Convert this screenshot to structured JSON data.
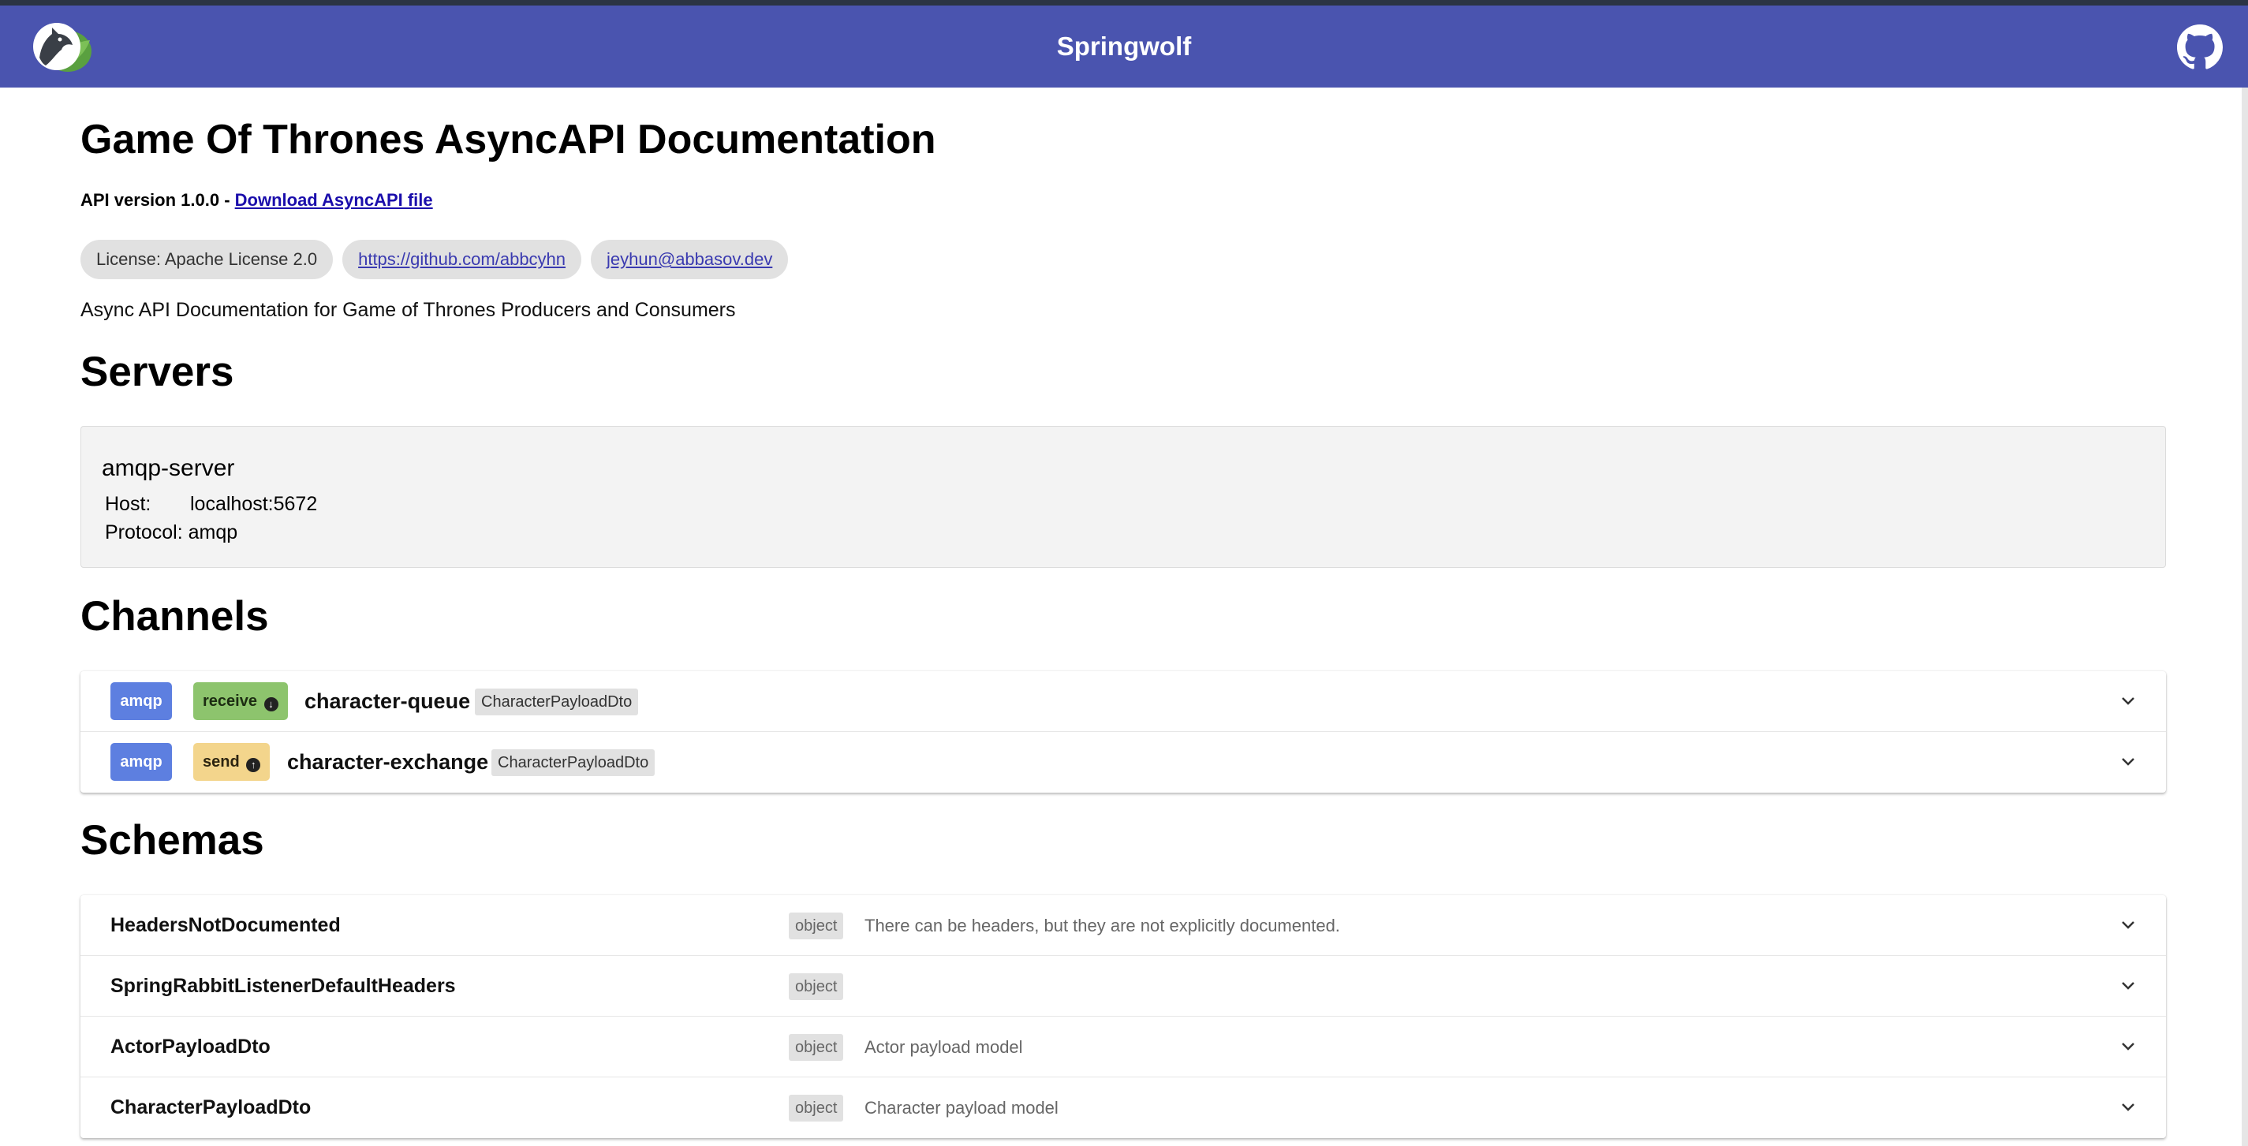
{
  "header": {
    "title": "Springwolf"
  },
  "info": {
    "title": "Game Of Thrones AsyncAPI Documentation",
    "api_version_text": "API version 1.0.0 - ",
    "download_label": "Download AsyncAPI file",
    "license_chip": "License: Apache License 2.0",
    "url_chip": "https://github.com/abbcyhn",
    "email_chip": "jeyhun@abbasov.dev",
    "description": "Async API Documentation for Game of Thrones Producers and Consumers"
  },
  "servers": {
    "heading": "Servers",
    "items": [
      {
        "name": "amqp-server",
        "host_label": "Host:",
        "host": "localhost:5672",
        "protocol_label": "Protocol:",
        "protocol": "amqp"
      }
    ]
  },
  "channels": {
    "heading": "Channels",
    "items": [
      {
        "protocol": "amqp",
        "operation": "receive",
        "name": "character-queue",
        "payload": "CharacterPayloadDto"
      },
      {
        "protocol": "amqp",
        "operation": "send",
        "name": "character-exchange",
        "payload": "CharacterPayloadDto"
      }
    ]
  },
  "schemas": {
    "heading": "Schemas",
    "items": [
      {
        "name": "HeadersNotDocumented",
        "type": "object",
        "description": "There can be headers, but they are not explicitly documented."
      },
      {
        "name": "SpringRabbitListenerDefaultHeaders",
        "type": "object",
        "description": ""
      },
      {
        "name": "ActorPayloadDto",
        "type": "object",
        "description": "Actor payload model"
      },
      {
        "name": "CharacterPayloadDto",
        "type": "object",
        "description": "Character payload model"
      }
    ]
  },
  "icons": {
    "logo": "springwolf-logo-icon",
    "github": "github-icon",
    "receive": "arrow-circle-down-icon",
    "send": "arrow-circle-up-icon",
    "expand": "chevron-down-icon"
  },
  "colors": {
    "toolbar": "#4a54af",
    "protocol_badge": "#5d7fe0",
    "receive_badge": "#8dc46d",
    "send_badge": "#f3d58c"
  }
}
